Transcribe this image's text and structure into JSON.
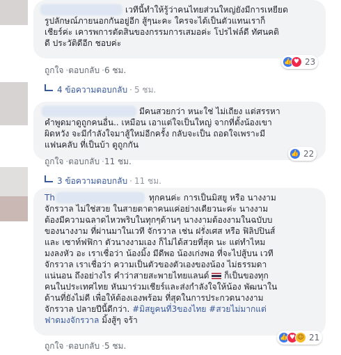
{
  "comments": [
    {
      "lines": [
        "เวทีนี้ทำให้รู้ว่าคนไทยส่วนใหญ่ยังมีการเหยียด",
        "รูปลักษณ์ภายนอกกันอยู่อีก สู้ๆนะคะ ใครจะได้เป็นตัวแทนเราก็",
        "เชียร์ค่ะ เคารพการตัดสินของกรรมการเสมอค่ะ โปรไฟล์ดี ทัศนคติ",
        "ดี ประวัติดีอีก ชอบค่ะ"
      ],
      "like": "ถูกใจ",
      "reply": "ตอบกลับ",
      "time": "6 ชม.",
      "reactions": [
        "like",
        "love"
      ],
      "reaction_count": "23",
      "replies_text": "4 ข้อความตอบกลับ",
      "replies_time": "5 ชม."
    },
    {
      "lines": [
        "มีคนสวยกว่า หนะใช่ ไม่เถียง แต่สรรหา",
        "คำพูดมาดูถูกคนอื่น.. เหมือน เอาแต่ใจเป็นใหญ่ จากที่ตั้งน้องเขา",
        "ผิดหวัง จะมีกำลังใจมาสู้ใหม่อีกครั้ง กลับจะเป็น ถอดใจเพราะมี",
        "แฟนคลับ ที่เป็นบ้า ดูถูกกัน"
      ],
      "like": "ถูกใจ",
      "reply": "ตอบกลับ",
      "time": "11 ชม.",
      "reactions": [
        "like"
      ],
      "reaction_count": "22",
      "replies_text": "3 ข้อความตอบกลับ",
      "replies_time": "11 ชม."
    },
    {
      "name_partial": "Th",
      "lines": [
        "ทุกคนค่ะ การเป็นมิสยู หรือ นางงาม",
        "จักรวาล ไม่ใช่สวย ในสายตาตาคนแค่อย่างเดียวนะค่ะ นางงาม",
        "ต้องมีความฉลาดไหวพริบในทุกๆด้านๆ นางงามต้องงามในฉบับบ",
        "ของนางงาม ที่ผ่านมาในเวที จักรวาล เช่น ฝรั่งเศส หรือ ฟิลิปปินส์",
        "และ เซาท์ฟฟิกา ตัวนางงามเอง ก็ไม่ได้สวยที่สุด นะ แต่ทำไหม",
        "มงลงหัว อะ เราเชื่อว่า น้องมิ้ง มีดีพอ น้องเก่งพอ ที่จะไปสู้บน เวที",
        "จักรวาล เราเชื่อว่า ความเป็นตัวของตัวเองของน้อง ไม่ธรรมดา",
        "แน่นอน ถึงอย่างไร คำว่าสายสะพายไทยแลนด์",
        "คนในประเทศไทย หันมาร่วมเชียร์และส่งกำลังใจให้น้อง พัฒนาใน",
        "ด้านที่ยังไม่ดี เพื่อให้ต้องเองพร้อม ที่สุดในการประกวดนางงาม",
        "จักรวาล ปลายปีนี้ดีกว่า."
      ],
      "line8_after_flag": "ก็เป็นของทุก",
      "hashtag1": "#มิสยูคนที่3ของไทย",
      "hashtag2": "#สวยไม่มากแต่",
      "hashtag_line_start": "ฟาดมงจักรวาล",
      "line_end": "มิ้งสู้ๆ จร้า",
      "like": "ถูกใจ",
      "reply": "ตอบกลับ",
      "time": "5 ชม.",
      "reactions": [
        "like",
        "love",
        "haha"
      ],
      "reaction_count": "21"
    }
  ],
  "colors": {
    "link": "#385898",
    "meta": "#606770",
    "bubble": "#f2f3f5"
  }
}
